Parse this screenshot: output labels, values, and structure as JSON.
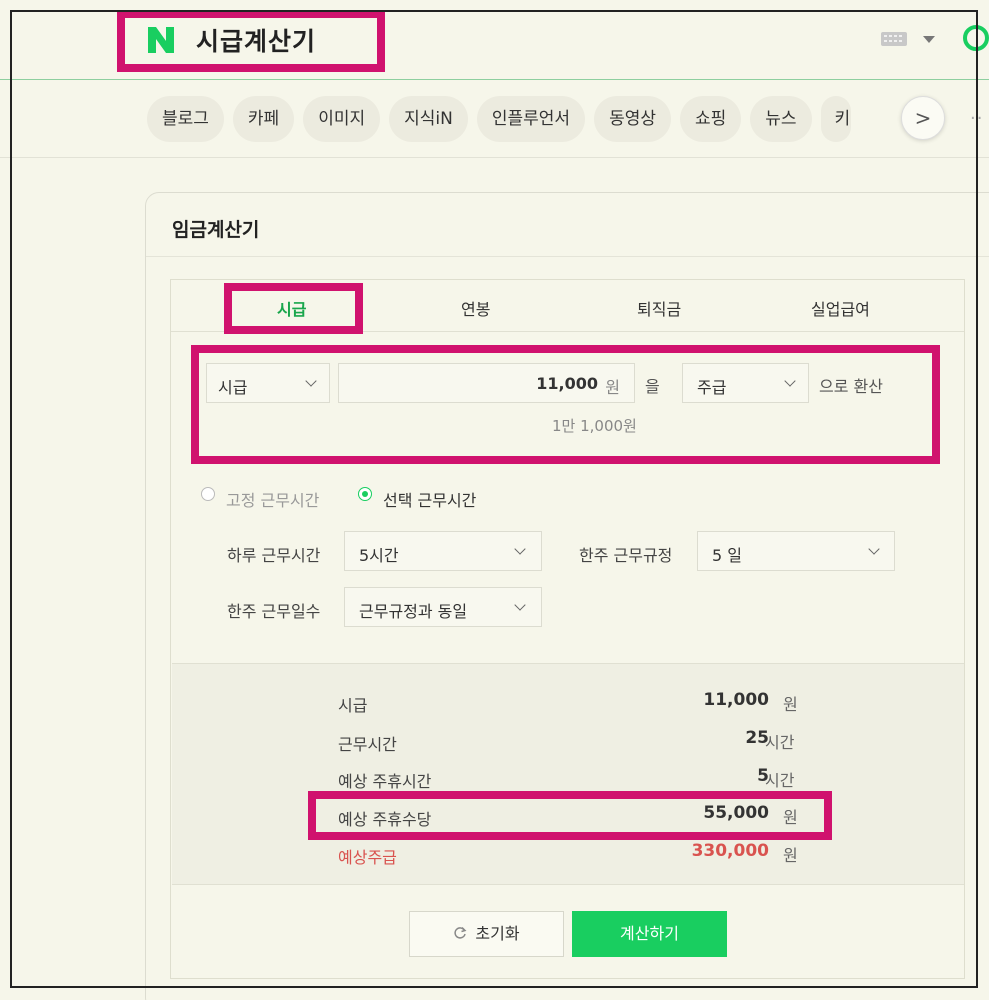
{
  "header": {
    "logo_letter": "N",
    "title": "시급계산기"
  },
  "nav": {
    "tabs": [
      "블로그",
      "카페",
      "이미지",
      "지식iN",
      "인플루언서",
      "동영상",
      "쇼핑",
      "뉴스",
      "키"
    ],
    "next_label": ">",
    "more_label": "··"
  },
  "calculator": {
    "title": "임금계산기",
    "tabs": [
      "시급",
      "연봉",
      "퇴직금",
      "실업급여"
    ],
    "active_tab": "시급",
    "convert": {
      "from_type": "시급",
      "amount": "11,000",
      "amount_unit": "원",
      "particle": "을",
      "to_type": "주급",
      "suffix": "으로 환산",
      "amount_korean": "1만 1,000원"
    },
    "hours_mode": {
      "fixed_label": "고정 근무시간",
      "select_label": "선택 근무시간",
      "selected": "선택 근무시간"
    },
    "options": {
      "daily_hours_label": "하루 근무시간",
      "daily_hours_value": "5시간",
      "weekly_rule_label": "한주 근무규정",
      "weekly_rule_value": "5 일",
      "weekly_days_label": "한주 근무일수",
      "weekly_days_value": "근무규정과 동일"
    },
    "results": [
      {
        "label": "시급",
        "value": "11,000",
        "unit": "원"
      },
      {
        "label": "근무시간",
        "value": "25",
        "unit": "시간"
      },
      {
        "label": "예상 주휴시간",
        "value": "5",
        "unit": "시간"
      },
      {
        "label": "예상 주휴수당",
        "value": "55,000",
        "unit": "원"
      },
      {
        "label": "예상주급",
        "value": "330,000",
        "unit": "원"
      }
    ],
    "buttons": {
      "reset": "초기화",
      "calculate": "계산하기"
    }
  },
  "colors": {
    "brand_green": "#19ce60",
    "highlight": "#d0126e",
    "emphasis_red": "#d9534f"
  }
}
